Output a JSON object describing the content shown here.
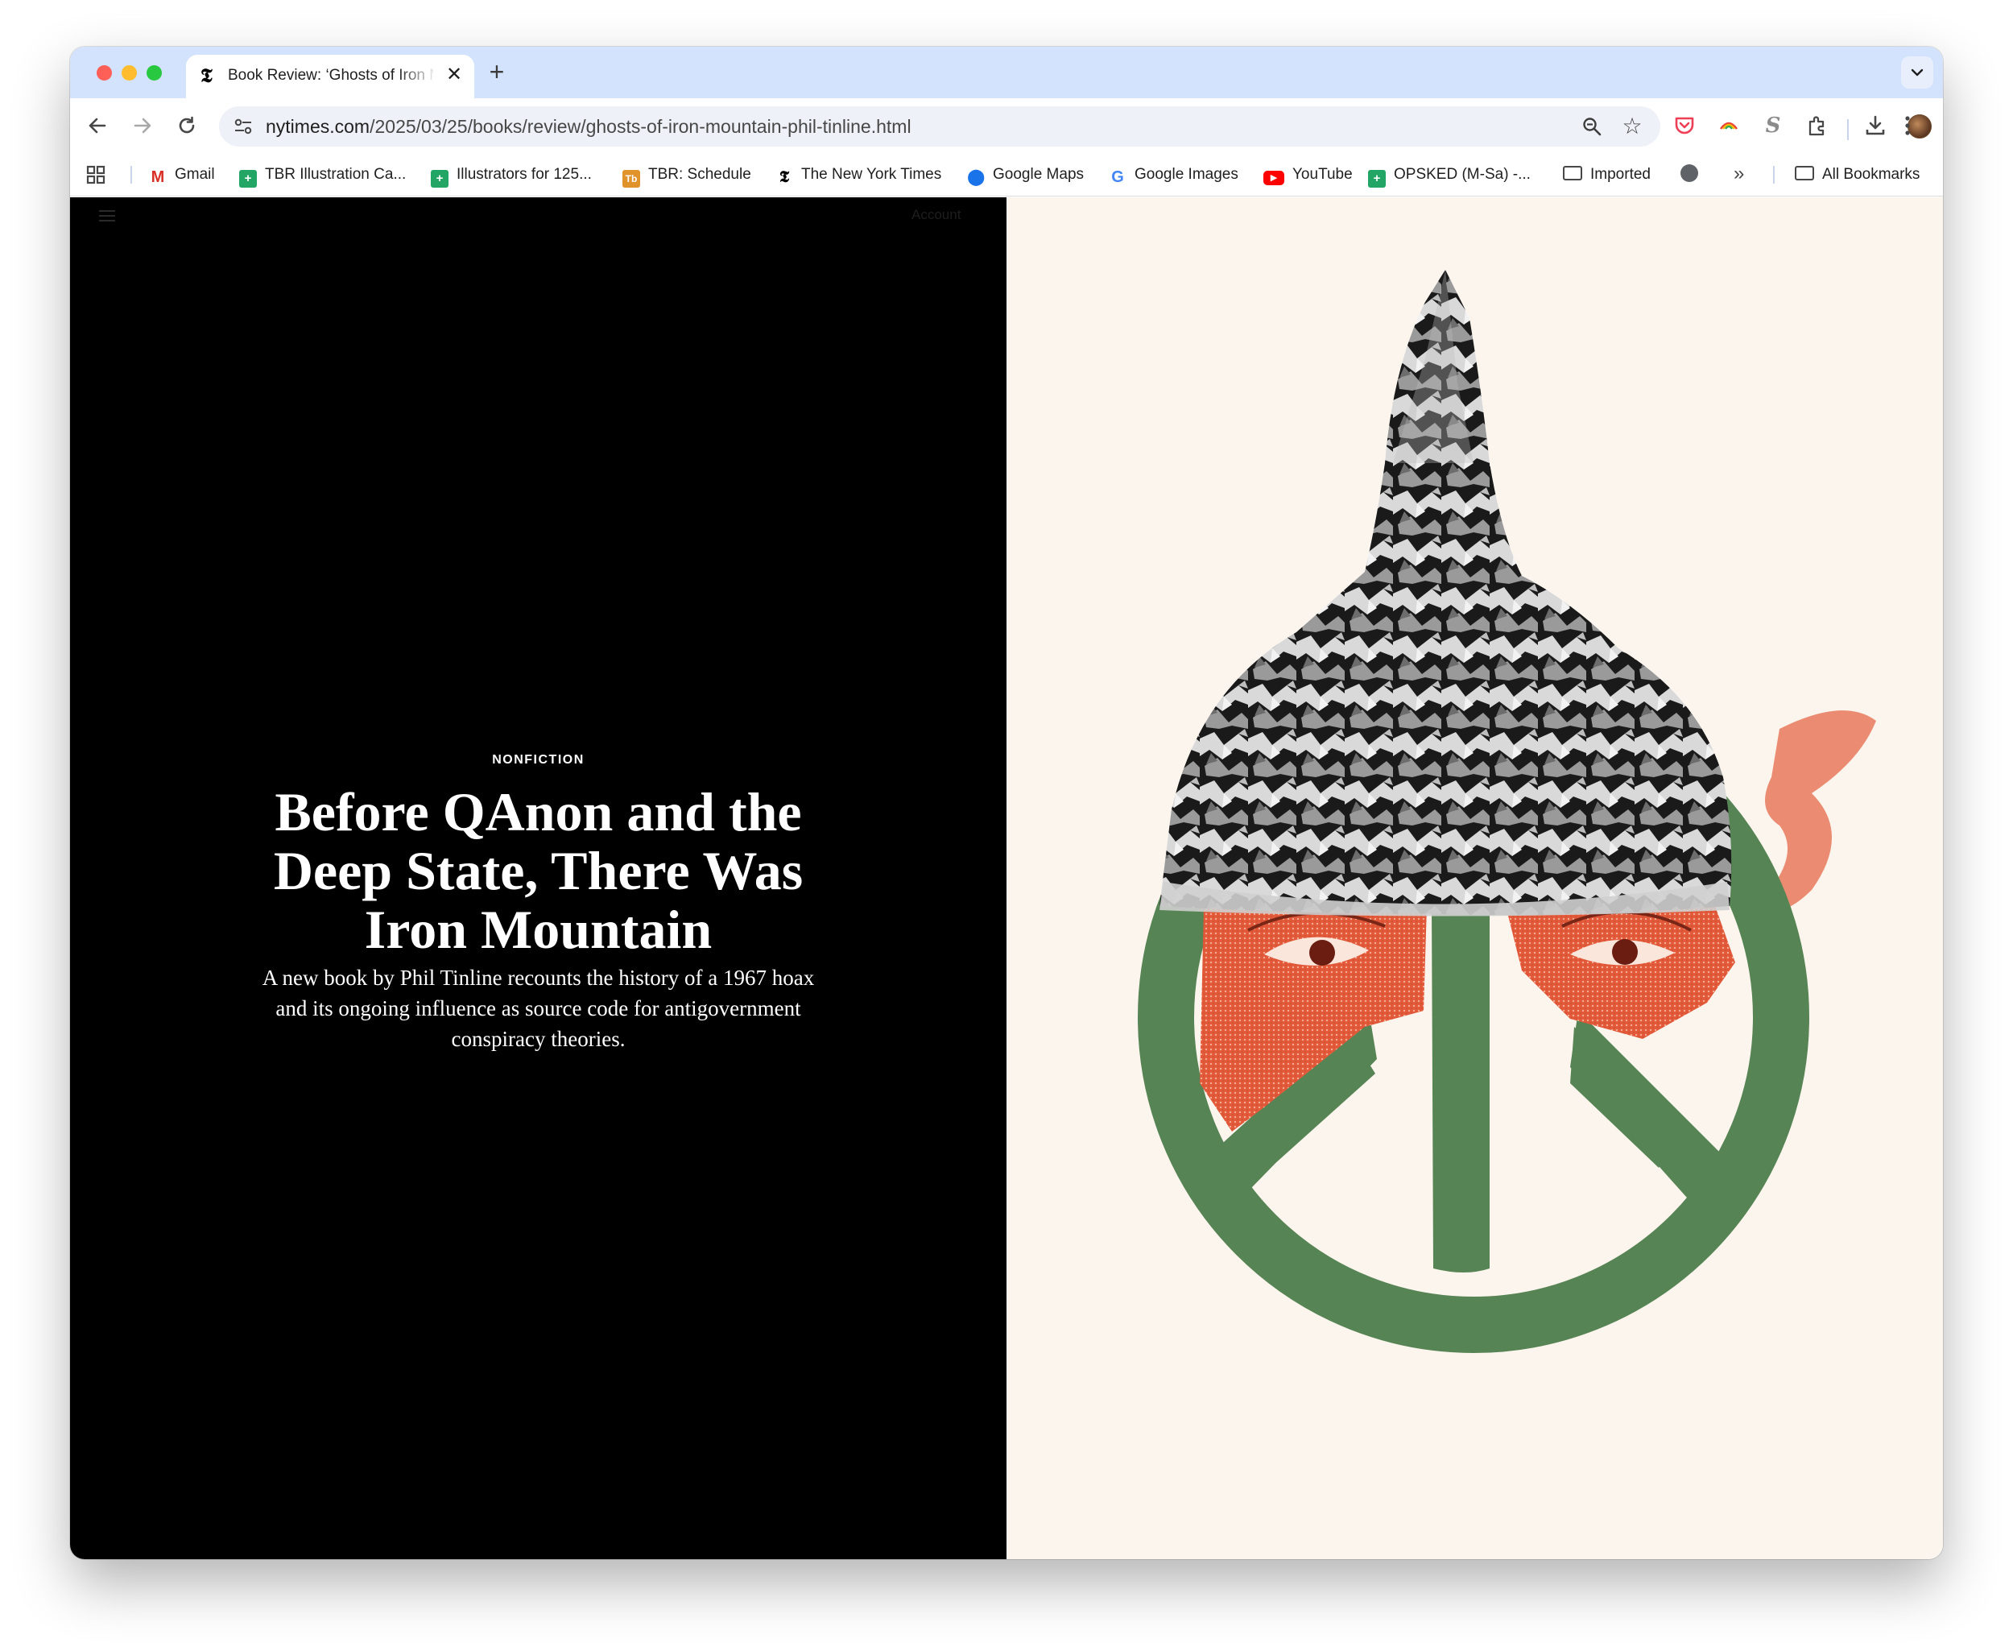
{
  "browser": {
    "tab": {
      "title": "Book Review: ‘Ghosts of Iron Mountain’",
      "favicon": "nyt-logo-icon"
    },
    "new_tab_label": "+",
    "url_domain": "nytimes.com",
    "url_path": "/2025/03/25/books/review/ghosts-of-iron-mountain-phil-tinline.html"
  },
  "bookmarks": [
    {
      "label": "Gmail",
      "icon": "gmail-icon"
    },
    {
      "label": "TBR Illustration Ca...",
      "icon": "sheets-icon"
    },
    {
      "label": "Illustrators for 125...",
      "icon": "sheets-icon"
    },
    {
      "label": "TBR: Schedule",
      "icon": "tb-icon"
    },
    {
      "label": "The New York Times",
      "icon": "nyt-icon"
    },
    {
      "label": "Google Maps",
      "icon": "maps-icon"
    },
    {
      "label": "Google Images",
      "icon": "google-icon"
    },
    {
      "label": "YouTube",
      "icon": "youtube-icon"
    },
    {
      "label": "OPSKED (M-Sa) -...",
      "icon": "sheets-icon"
    },
    {
      "label": "Imported",
      "icon": "folder-icon"
    },
    {
      "label": "All Bookmarks",
      "icon": "folder-icon"
    }
  ],
  "article": {
    "menu_icon": "hamburger-icon",
    "account_label": "Account",
    "kicker": "NONFICTION",
    "headline": "Before QAnon and the Deep State, There Was Iron Mountain",
    "dek": "A new book by Phil Tinline recounts the history of a 1967 hoax and its ongoing influence as source code for antigovernment conspiracy theories."
  },
  "colors": {
    "left_bg": "#000000",
    "right_bg": "#fbf5ee",
    "peace_green": "#578454",
    "face_orange": "#e35a3a",
    "tab_strip": "#d3e3fd"
  }
}
